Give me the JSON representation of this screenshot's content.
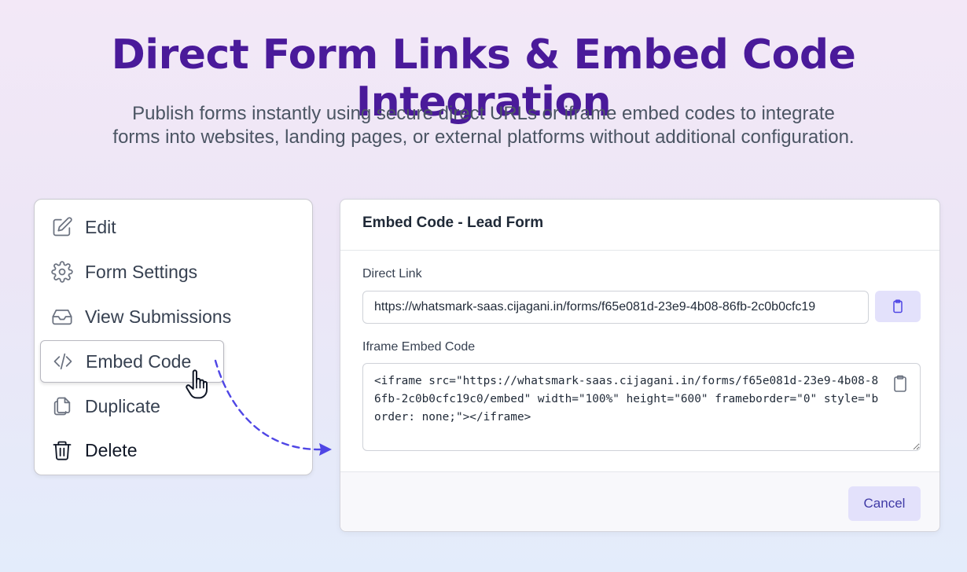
{
  "hero": {
    "title": "Direct Form Links & Embed Code Integration",
    "subtitle_line1": "Publish forms instantly using secure direct URLs or iframe embed codes to integrate",
    "subtitle_line2": "forms into websites, landing pages, or external platforms without additional configuration."
  },
  "menu": {
    "items": [
      {
        "label": "Edit",
        "icon": "pencil-icon"
      },
      {
        "label": "Form Settings",
        "icon": "gear-icon"
      },
      {
        "label": "View Submissions",
        "icon": "inbox-icon"
      },
      {
        "label": "Embed Code",
        "icon": "code-icon",
        "active": true
      },
      {
        "label": "Duplicate",
        "icon": "copy-icon"
      },
      {
        "label": "Delete",
        "icon": "trash-icon"
      }
    ]
  },
  "modal": {
    "title": "Embed Code - Lead Form",
    "direct_link_label": "Direct Link",
    "direct_link_value": "https://whatsmark-saas.cijagani.in/forms/f65e081d-23e9-4b08-86fb-2c0b0cfc19",
    "iframe_label": "Iframe Embed Code",
    "iframe_code": "<iframe src=\"https://whatsmark-saas.cijagani.in/forms/f65e081d-23e9-4b08-86fb-2c0b0cfc19c0/embed\" width=\"100%\" height=\"600\" frameborder=\"0\" style=\"border: none;\"></iframe>",
    "cancel_label": "Cancel"
  },
  "colors": {
    "title": "#4a1a9a",
    "accent_button_bg": "#e3e1fb",
    "accent_button_text": "#3f3aa6",
    "arrow": "#4f46e5"
  }
}
